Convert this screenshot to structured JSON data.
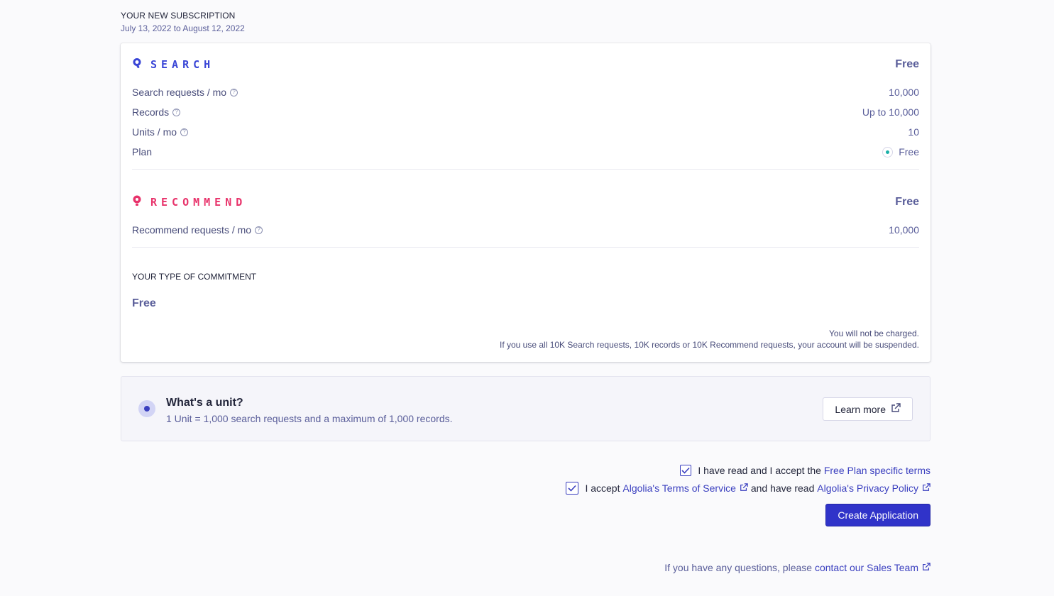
{
  "subscription": {
    "title": "YOUR NEW SUBSCRIPTION",
    "dates": "July 13, 2022 to August 12, 2022"
  },
  "search": {
    "name": "SEARCH",
    "price": "Free",
    "color": "#3a46d6",
    "rows": [
      {
        "label": "Search requests / mo",
        "value": "10,000",
        "help": true
      },
      {
        "label": "Records",
        "value": "Up to 10,000",
        "help": true
      },
      {
        "label": "Units / mo",
        "value": "10",
        "help": true
      },
      {
        "label": "Plan",
        "value": "Free",
        "help": false
      }
    ],
    "help_glyph": "?"
  },
  "recommend": {
    "name": "RECOMMEND",
    "price": "Free",
    "color": "#e8336b",
    "rows": [
      {
        "label": "Recommend requests / mo",
        "value": "10,000",
        "help": true
      }
    ]
  },
  "commitment": {
    "title": "YOUR TYPE OF COMMITMENT",
    "value": "Free",
    "notice_line1": "You will not be charged.",
    "notice_line2": "If you use all 10K Search requests, 10K records or 10K Recommend requests, your account will be suspended."
  },
  "unit_info": {
    "title": "What's a unit?",
    "description": "1 Unit = 1,000 search requests and a maximum of 1,000 records.",
    "learn_more": "Learn more"
  },
  "terms": {
    "free_plan": {
      "prefix": "I have read and I accept the ",
      "link": "Free Plan specific terms",
      "checked": true
    },
    "tos": {
      "prefix": "I accept ",
      "tos_link": "Algolia's Terms of Service",
      "middle": " and have read ",
      "privacy_link": "Algolia's Privacy Policy",
      "checked": true
    }
  },
  "create_button": "Create Application",
  "footer": {
    "prefix": "If you have any questions, please ",
    "link": "contact our Sales Team"
  },
  "icons": {
    "search": "search-logo-icon",
    "recommend": "recommend-logo-icon",
    "help": "help-circle-icon",
    "external": "external-link-icon",
    "check": "check-icon"
  },
  "colors": {
    "primary": "#3033c9",
    "link": "#3a3fbf",
    "muted": "#5a5e9a",
    "plan_dot": "#1bb0a8"
  }
}
